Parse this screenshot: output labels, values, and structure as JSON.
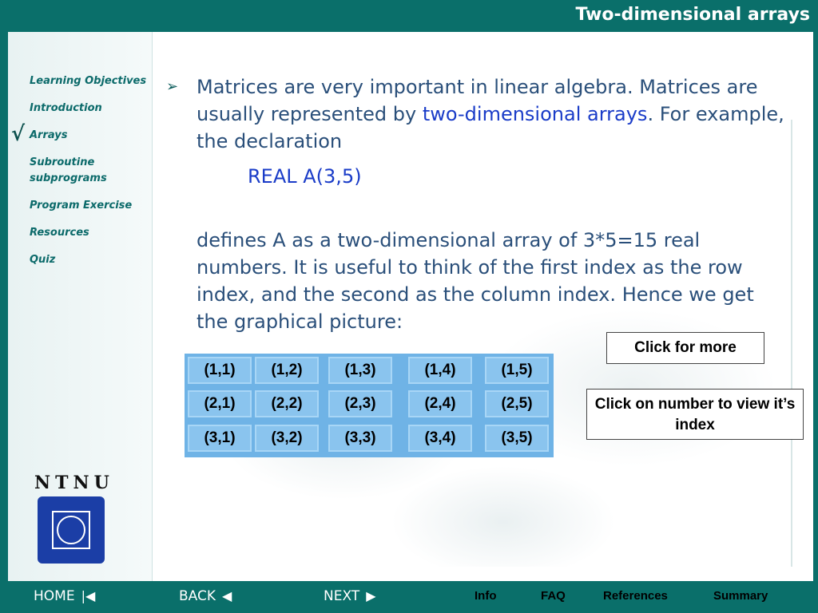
{
  "header": {
    "title": "Two-dimensional arrays"
  },
  "sidebar": {
    "items": [
      {
        "label": "Learning Objectives"
      },
      {
        "label": "Introduction"
      },
      {
        "label": "Arrays"
      },
      {
        "label": "Subroutine subprograms"
      },
      {
        "label": "Program Exercise"
      },
      {
        "label": "Resources"
      },
      {
        "label": "Quiz"
      }
    ],
    "current_marker": "√"
  },
  "content": {
    "bullet_symbol": "➢",
    "para1_part1": "Matrices are very important in linear algebra. Matrices are usually represented by ",
    "para1_highlight": "two-dimensional arrays",
    "para1_part2": ". For example, the declaration",
    "code": "REAL A(3,5)",
    "para2": "defines A as a two-dimensional array of 3*5=15 real numbers. It is useful to think of the first index as the row index, and the second as the column index. Hence we get the graphical picture:"
  },
  "buttons": {
    "click_more": "Click for more",
    "click_index": "Click on number to view it’s index"
  },
  "matrix": {
    "rows": [
      [
        "(1,1)",
        "(1,2)",
        "(1,3)",
        "(1,4)",
        "(1,5)"
      ],
      [
        "(2,1)",
        "(2,2)",
        "(2,3)",
        "(2,4)",
        "(2,5)"
      ],
      [
        "(3,1)",
        "(3,2)",
        "(3,3)",
        "(3,4)",
        "(3,5)"
      ]
    ]
  },
  "logo": {
    "text": "NTNU"
  },
  "footer": {
    "home": "HOME",
    "back": "BACK",
    "next": "NEXT",
    "links": [
      "Info",
      "FAQ",
      "References",
      "Summary"
    ]
  },
  "colors": {
    "frame": "#0a6f6a",
    "nav_text": "#0b6a6a",
    "body_text": "#2a4f7a",
    "highlight": "#1a3cc8",
    "cell_bg": "#8ac4ee",
    "logo_blue": "#1b3ea6"
  }
}
